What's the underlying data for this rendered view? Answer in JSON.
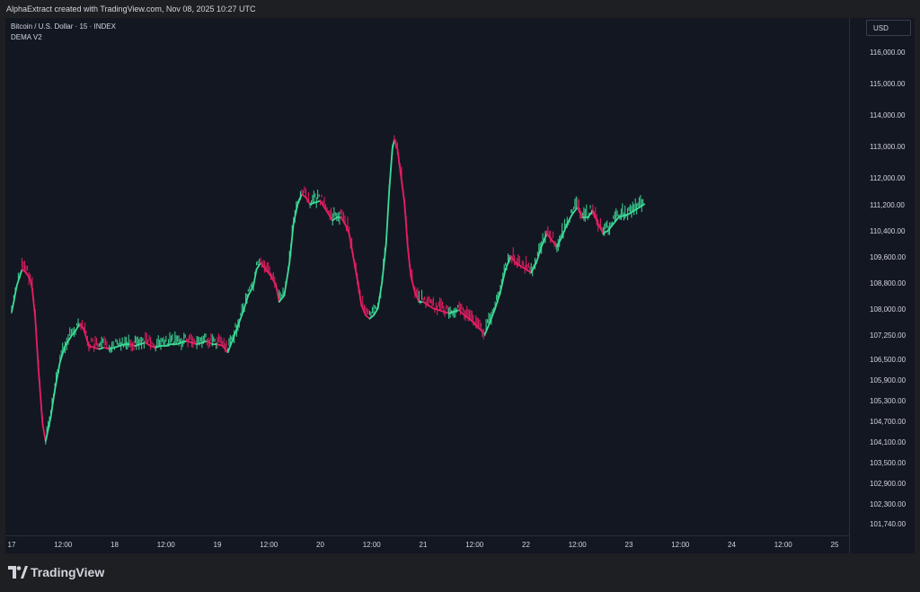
{
  "header": {
    "attribution": "AlphaExtract created with TradingView.com, Nov 08, 2025 10:27 UTC"
  },
  "legend": {
    "symbol": "Bitcoin / U.S. Dollar · 15 · INDEX",
    "indicator": "DEMA V2"
  },
  "currency": "USD",
  "footer": {
    "brand": "TradingView"
  },
  "colors": {
    "background": "#131722",
    "bullish": "#3ddc97",
    "bearish": "#e91e63",
    "text": "#d1d4dc"
  },
  "chart_data": {
    "type": "line",
    "series": [
      {
        "values": [
          [
            0,
            108000
          ],
          [
            0.02,
            108300
          ],
          [
            0.05,
            108800
          ],
          [
            0.08,
            109100
          ],
          [
            0.1,
            109300
          ],
          [
            0.14,
            109200
          ],
          [
            0.18,
            109000
          ],
          [
            0.2,
            108700
          ],
          [
            0.23,
            107800
          ],
          [
            0.26,
            106300
          ],
          [
            0.3,
            104700
          ],
          [
            0.33,
            104200
          ],
          [
            0.38,
            104900
          ],
          [
            0.42,
            105700
          ],
          [
            0.47,
            106500
          ],
          [
            0.52,
            107000
          ],
          [
            0.58,
            107300
          ],
          [
            0.62,
            107450
          ],
          [
            0.66,
            107650
          ],
          [
            0.7,
            107500
          ],
          [
            0.75,
            107000
          ],
          [
            0.8,
            106950
          ],
          [
            0.85,
            106900
          ],
          [
            0.9,
            106950
          ],
          [
            0.95,
            106900
          ],
          [
            1.0,
            106950
          ],
          [
            1.05,
            107000
          ],
          [
            1.1,
            107050
          ],
          [
            1.15,
            107050
          ],
          [
            1.2,
            107000
          ],
          [
            1.25,
            107050
          ],
          [
            1.3,
            107100
          ],
          [
            1.35,
            107000
          ],
          [
            1.4,
            106950
          ],
          [
            1.45,
            107000
          ],
          [
            1.5,
            107000
          ],
          [
            1.55,
            107050
          ],
          [
            1.6,
            107050
          ],
          [
            1.65,
            107100
          ],
          [
            1.7,
            107150
          ],
          [
            1.75,
            107100
          ],
          [
            1.8,
            107050
          ],
          [
            1.85,
            107100
          ],
          [
            1.9,
            107150
          ],
          [
            1.95,
            107050
          ],
          [
            2.0,
            107050
          ],
          [
            2.05,
            107000
          ],
          [
            2.1,
            106800
          ],
          [
            2.15,
            107200
          ],
          [
            2.2,
            107600
          ],
          [
            2.25,
            108000
          ],
          [
            2.3,
            108500
          ],
          [
            2.35,
            108800
          ],
          [
            2.38,
            109300
          ],
          [
            2.42,
            109500
          ],
          [
            2.47,
            109300
          ],
          [
            2.52,
            109100
          ],
          [
            2.57,
            108800
          ],
          [
            2.6,
            108300
          ],
          [
            2.65,
            108500
          ],
          [
            2.7,
            109500
          ],
          [
            2.74,
            110700
          ],
          [
            2.78,
            111300
          ],
          [
            2.82,
            111600
          ],
          [
            2.86,
            111500
          ],
          [
            2.9,
            111300
          ],
          [
            2.95,
            111350
          ],
          [
            3.0,
            111400
          ],
          [
            3.04,
            111200
          ],
          [
            3.08,
            111000
          ],
          [
            3.12,
            110800
          ],
          [
            3.16,
            110900
          ],
          [
            3.2,
            110900
          ],
          [
            3.24,
            110700
          ],
          [
            3.28,
            110400
          ],
          [
            3.32,
            109700
          ],
          [
            3.36,
            109000
          ],
          [
            3.4,
            108200
          ],
          [
            3.44,
            107900
          ],
          [
            3.48,
            107800
          ],
          [
            3.52,
            107900
          ],
          [
            3.56,
            108100
          ],
          [
            3.6,
            108900
          ],
          [
            3.64,
            110100
          ],
          [
            3.67,
            111700
          ],
          [
            3.7,
            113000
          ],
          [
            3.72,
            113300
          ],
          [
            3.75,
            113000
          ],
          [
            3.79,
            112000
          ],
          [
            3.82,
            111300
          ],
          [
            3.85,
            110000
          ],
          [
            3.88,
            109100
          ],
          [
            3.92,
            108600
          ],
          [
            3.96,
            108300
          ],
          [
            4.0,
            108300
          ],
          [
            4.05,
            108200
          ],
          [
            4.1,
            108100
          ],
          [
            4.15,
            108050
          ],
          [
            4.2,
            108000
          ],
          [
            4.25,
            107950
          ],
          [
            4.3,
            108000
          ],
          [
            4.35,
            108050
          ],
          [
            4.4,
            107900
          ],
          [
            4.45,
            107800
          ],
          [
            4.5,
            107650
          ],
          [
            4.55,
            107500
          ],
          [
            4.6,
            107350
          ],
          [
            4.65,
            107700
          ],
          [
            4.7,
            108100
          ],
          [
            4.75,
            108600
          ],
          [
            4.8,
            109300
          ],
          [
            4.85,
            109700
          ],
          [
            4.9,
            109500
          ],
          [
            4.95,
            109400
          ],
          [
            5.0,
            109300
          ],
          [
            5.05,
            109200
          ],
          [
            5.1,
            109500
          ],
          [
            5.15,
            110000
          ],
          [
            5.2,
            110400
          ],
          [
            5.25,
            110200
          ],
          [
            5.3,
            110000
          ],
          [
            5.35,
            110300
          ],
          [
            5.4,
            110700
          ],
          [
            5.45,
            111000
          ],
          [
            5.5,
            111200
          ],
          [
            5.55,
            110900
          ],
          [
            5.6,
            110900
          ],
          [
            5.65,
            111100
          ],
          [
            5.7,
            110700
          ],
          [
            5.75,
            110400
          ],
          [
            5.8,
            110500
          ],
          [
            5.85,
            110700
          ],
          [
            5.9,
            110900
          ],
          [
            5.95,
            110950
          ],
          [
            6.0,
            111000
          ],
          [
            6.05,
            111100
          ],
          [
            6.1,
            111200
          ],
          [
            6.15,
            111300
          ]
        ]
      }
    ],
    "x_ticks": [
      "17",
      "12:00",
      "18",
      "12:00",
      "19",
      "12:00",
      "20",
      "12:00",
      "21",
      "12:00",
      "22",
      "12:00",
      "23",
      "12:00",
      "24",
      "12:00",
      "25"
    ],
    "y_ticks": [
      "116,000.00",
      "115,000.00",
      "114,000.00",
      "113,000.00",
      "112,000.00",
      "111,200.00",
      "110,400.00",
      "109,600.00",
      "108,800.00",
      "108,000.00",
      "107,250.00",
      "106,500.00",
      "105,900.00",
      "105,300.00",
      "104,700.00",
      "104,100.00",
      "103,500.00",
      "102,900.00",
      "102,300.00",
      "101,740.00"
    ],
    "grid": false
  }
}
